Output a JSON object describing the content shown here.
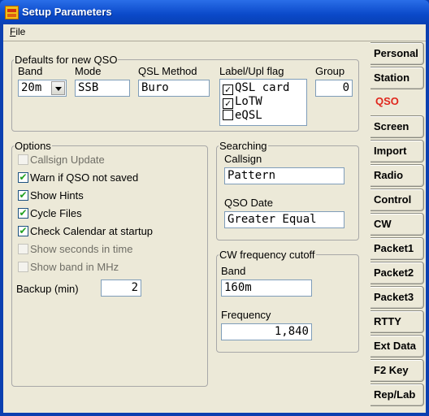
{
  "window": {
    "title": "Setup Parameters"
  },
  "menu": {
    "file_label": "File",
    "file_underline": "F",
    "file_rest": "ile"
  },
  "defaults": {
    "legend": "Defaults for new QSO",
    "band_label": "Band",
    "band_value": "20m",
    "mode_label": "Mode",
    "mode_value": "SSB",
    "qsl_label": "QSL Method",
    "qsl_value": "Buro",
    "flag_label": "Label/Upl flag",
    "flags": [
      {
        "label": "QSL card",
        "checked": true
      },
      {
        "label": "LoTW",
        "checked": true
      },
      {
        "label": "eQSL",
        "checked": false
      }
    ],
    "group_label": "Group",
    "group_value": "0"
  },
  "options": {
    "legend": "Options",
    "items": [
      {
        "label": "Callsign Update",
        "checked": false,
        "enabled": false
      },
      {
        "label": "Warn if QSO not saved",
        "checked": true,
        "enabled": true
      },
      {
        "label": "Show Hints",
        "checked": true,
        "enabled": true
      },
      {
        "label": "Cycle Files",
        "checked": true,
        "enabled": true
      },
      {
        "label": "Check Calendar at startup",
        "checked": true,
        "enabled": true
      },
      {
        "label": "Show seconds in time",
        "checked": false,
        "enabled": false
      },
      {
        "label": "Show band in MHz",
        "checked": false,
        "enabled": false
      }
    ],
    "backup_label": "Backup (min)",
    "backup_value": "2"
  },
  "searching": {
    "legend": "Searching",
    "callsign_label": "Callsign",
    "callsign_value": "Pattern",
    "date_label": "QSO Date",
    "date_value": "Greater Equal"
  },
  "cw_cutoff": {
    "legend": "CW frequency cutoff",
    "band_label": "Band",
    "band_value": "160m",
    "freq_label": "Frequency",
    "freq_value": "1,840"
  },
  "tabs": [
    {
      "label": "Personal",
      "active": false
    },
    {
      "label": "Station",
      "active": false
    },
    {
      "label": "QSO",
      "active": true
    },
    {
      "label": "Screen",
      "active": false
    },
    {
      "label": "Import",
      "active": false
    },
    {
      "label": "Radio",
      "active": false
    },
    {
      "label": "Control",
      "active": false
    },
    {
      "label": "CW",
      "active": false
    },
    {
      "label": "Packet1",
      "active": false
    },
    {
      "label": "Packet2",
      "active": false
    },
    {
      "label": "Packet3",
      "active": false
    },
    {
      "label": "RTTY",
      "active": false
    },
    {
      "label": "Ext Data",
      "active": false
    },
    {
      "label": "F2 Key",
      "active": false
    },
    {
      "label": "Rep/Lab",
      "active": false
    }
  ],
  "colors": {
    "title_blue": "#0a49c9",
    "active_tab": "#e0261c",
    "check_green": "#21a121"
  }
}
